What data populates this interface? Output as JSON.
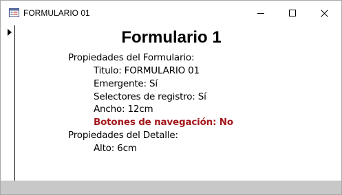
{
  "window": {
    "title": "FORMULARIO 01",
    "controls": {
      "minimize_icon": "minimize-icon",
      "maximize_icon": "maximize-icon",
      "close_icon": "close-icon"
    }
  },
  "form": {
    "heading": "Formulario 1",
    "lines": [
      {
        "text": "Propiedades del Formulario:"
      },
      {
        "text": "Titulo: FORMULARIO 01"
      },
      {
        "text": "Emergente: Sí"
      },
      {
        "text": "Selectores de registro: Sí"
      },
      {
        "text": "Ancho: 12cm"
      },
      {
        "text": "Botones de navegación: No"
      },
      {
        "text": "Propiedades del Detalle:"
      },
      {
        "text": "Alto: 6cm"
      }
    ]
  },
  "colors": {
    "highlight": "#a3181c",
    "statusbar": "#c8c8c8"
  }
}
